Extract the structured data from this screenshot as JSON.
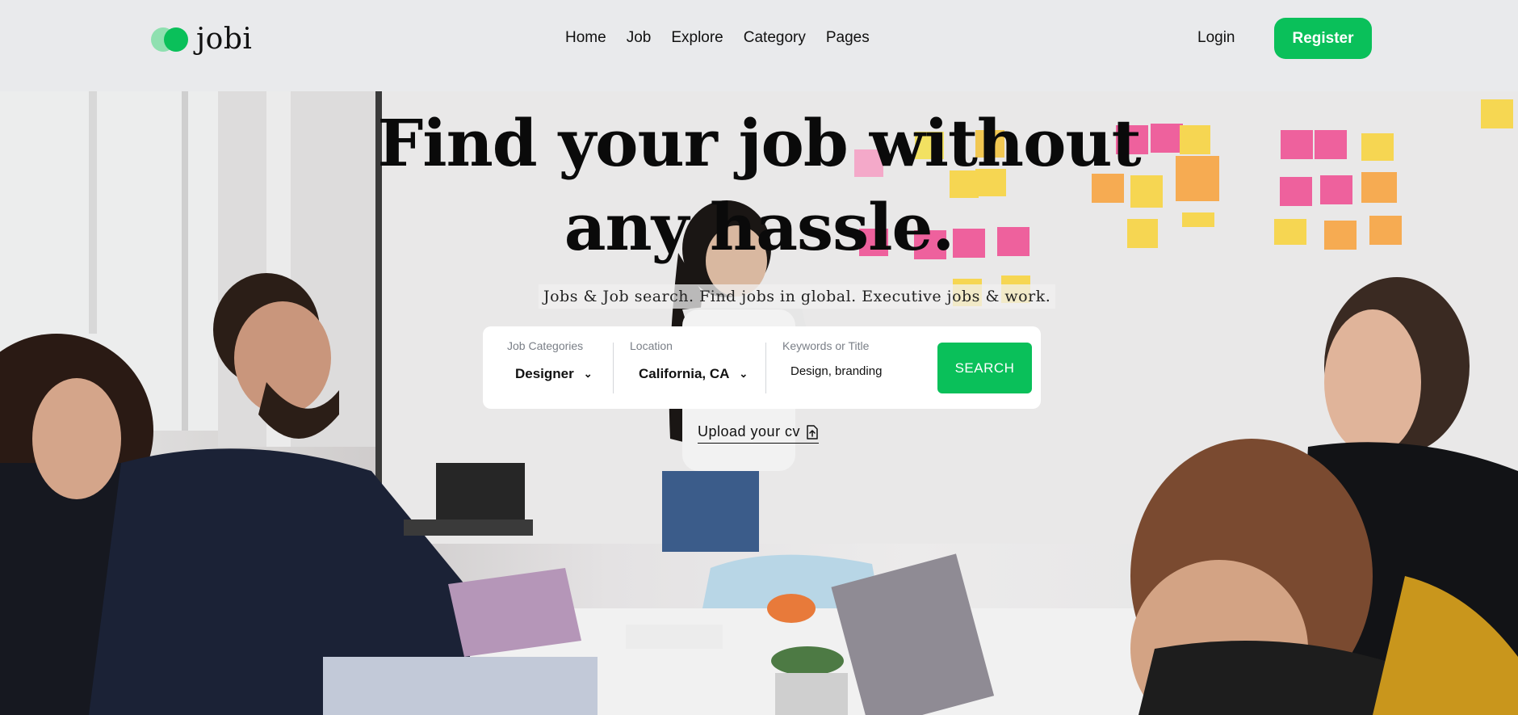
{
  "brand": {
    "name": "jobi",
    "accent": "#0ac05a",
    "accent_light": "#8fe0b0"
  },
  "nav": {
    "items": [
      "Home",
      "Job",
      "Explore",
      "Category",
      "Pages"
    ]
  },
  "auth": {
    "login": "Login",
    "register": "Register"
  },
  "hero": {
    "title_line1": "Find your job without",
    "title_line2": "any hassle.",
    "subtitle": "Jobs & Job search. Find jobs in global. Executive jobs & work.",
    "background": "office team meeting photo"
  },
  "search": {
    "category_label": "Job Categories",
    "category_value": "Designer",
    "location_label": "Location",
    "location_value": "California, CA",
    "keywords_label": "Keywords or Title",
    "keywords_value": "Design, branding",
    "button": "SEARCH"
  },
  "upload": {
    "label": "Upload your cv",
    "icon": "upload-file-icon"
  }
}
